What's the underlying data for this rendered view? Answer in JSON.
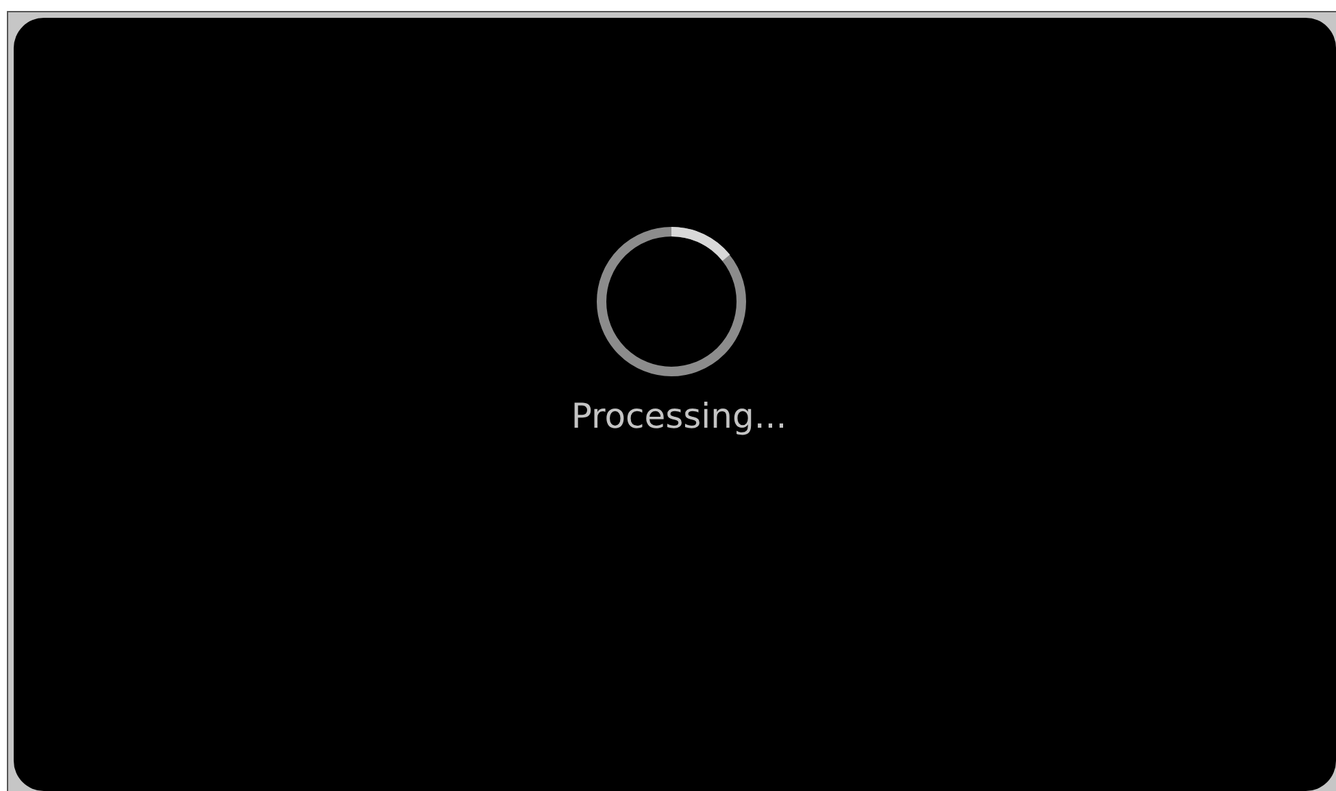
{
  "status": {
    "message": "Processing..."
  }
}
